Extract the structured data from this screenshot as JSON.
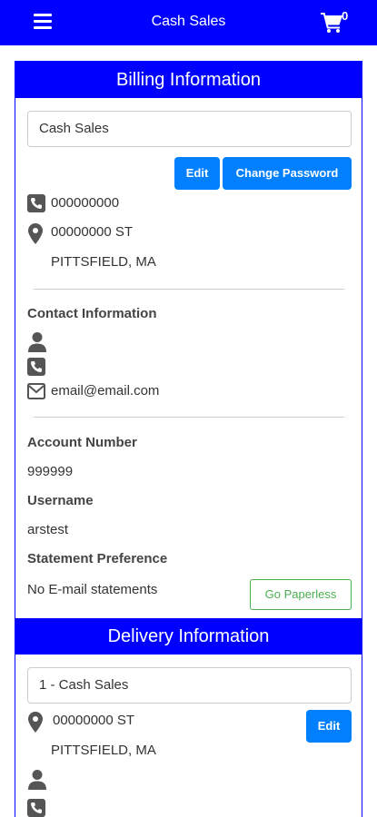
{
  "header": {
    "title": "Cash Sales",
    "cart_count": "0"
  },
  "billing": {
    "section_title": "Billing Information",
    "account_select": "Cash Sales",
    "edit_label": "Edit",
    "change_password_label": "Change Password",
    "phone": "000000000",
    "address_line1": "00000000 ST",
    "address_line2": "PITTSFIELD, MA",
    "contact_heading": "Contact Information",
    "contact_name": "",
    "contact_phone": "",
    "contact_email": "email@email.com",
    "account_number_label": "Account Number",
    "account_number": "999999",
    "username_label": "Username",
    "username": "arstest",
    "statement_pref_label": "Statement Preference",
    "statement_pref": "No E-mail statements",
    "go_paperless_label": "Go Paperless"
  },
  "delivery": {
    "section_title": "Delivery Information",
    "location_select": "1 - Cash Sales",
    "address_line1": "00000000 ST",
    "address_line2": "PITTSFIELD, MA",
    "edit_label": "Edit"
  },
  "colors": {
    "primary_blue": "#0000ff",
    "button_blue": "#0080ff",
    "paperless_green": "#4caf50"
  }
}
